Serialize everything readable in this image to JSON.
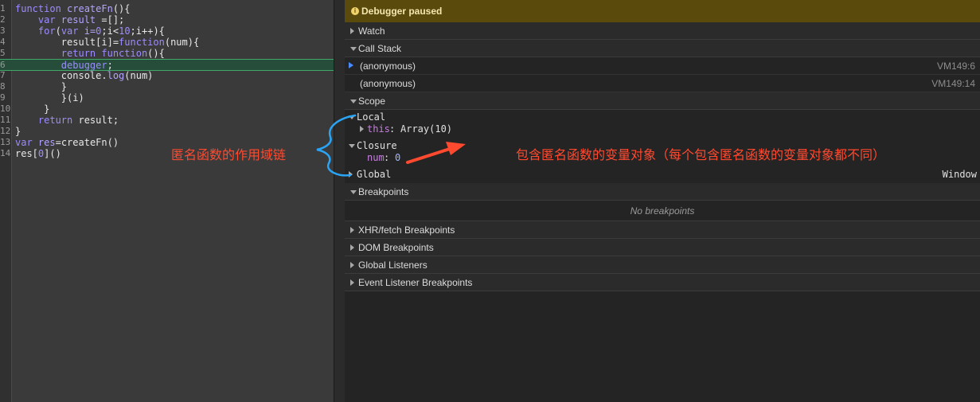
{
  "editor": {
    "lines": [
      {
        "n": "1",
        "tokens": [
          {
            "t": "function ",
            "c": "kw"
          },
          {
            "t": "createFn",
            "c": "fn"
          },
          {
            "t": "(){",
            "c": "pl"
          }
        ]
      },
      {
        "n": "2",
        "tokens": [
          {
            "t": "    var ",
            "c": "kw"
          },
          {
            "t": "result ",
            "c": "fn"
          },
          {
            "t": "=[];",
            "c": "pl"
          }
        ]
      },
      {
        "n": "3",
        "tokens": [
          {
            "t": "    for",
            "c": "kw"
          },
          {
            "t": "(",
            "c": "pl"
          },
          {
            "t": "var ",
            "c": "kw"
          },
          {
            "t": "i=",
            "c": "fn"
          },
          {
            "t": "0",
            "c": "num"
          },
          {
            "t": ";i<",
            "c": "pl"
          },
          {
            "t": "10",
            "c": "num"
          },
          {
            "t": ";i++){",
            "c": "pl"
          }
        ]
      },
      {
        "n": "4",
        "tokens": [
          {
            "t": "        result[i]=",
            "c": "pl"
          },
          {
            "t": "function",
            "c": "kw"
          },
          {
            "t": "(num){",
            "c": "pl"
          }
        ]
      },
      {
        "n": "5",
        "tokens": [
          {
            "t": "        return function",
            "c": "kw"
          },
          {
            "t": "(){",
            "c": "pl"
          }
        ]
      },
      {
        "n": "6",
        "tokens": [
          {
            "t": "        debugger",
            "c": "kw"
          },
          {
            "t": ";",
            "c": "pl"
          }
        ],
        "active": true
      },
      {
        "n": "7",
        "tokens": [
          {
            "t": "        console.",
            "c": "pl"
          },
          {
            "t": "log",
            "c": "fn"
          },
          {
            "t": "(num)",
            "c": "pl"
          }
        ]
      },
      {
        "n": "8",
        "tokens": [
          {
            "t": "        }",
            "c": "pl"
          }
        ]
      },
      {
        "n": "9",
        "tokens": [
          {
            "t": "        }(i)",
            "c": "pl"
          }
        ]
      },
      {
        "n": "10",
        "tokens": [
          {
            "t": "     }",
            "c": "pl"
          }
        ]
      },
      {
        "n": "11",
        "tokens": [
          {
            "t": "    return ",
            "c": "kw"
          },
          {
            "t": "result;",
            "c": "pl"
          }
        ]
      },
      {
        "n": "12",
        "tokens": [
          {
            "t": "}",
            "c": "pl"
          }
        ]
      },
      {
        "n": "13",
        "tokens": [
          {
            "t": "var ",
            "c": "kw"
          },
          {
            "t": "res",
            "c": "fn"
          },
          {
            "t": "=createFn()",
            "c": "pl"
          }
        ]
      },
      {
        "n": "14",
        "tokens": [
          {
            "t": "res[",
            "c": "pl"
          },
          {
            "t": "0",
            "c": "num"
          },
          {
            "t": "]()",
            "c": "pl"
          }
        ]
      }
    ]
  },
  "sidebar": {
    "banner": {
      "icon": "info-icon",
      "text": "Debugger paused",
      "color": "#5a4a0c"
    },
    "watch": "Watch",
    "call_stack": {
      "label": "Call Stack",
      "frames": [
        {
          "name": "(anonymous)",
          "location": "VM149:6",
          "current": true
        },
        {
          "name": "(anonymous)",
          "location": "VM149:14",
          "current": false
        }
      ]
    },
    "scope": {
      "label": "Scope",
      "local": "Local",
      "this_key": "this",
      "this_val": "Array(10)",
      "closure": "Closure",
      "num_key": "num",
      "num_val": "0",
      "global": "Global",
      "global_val": "Window"
    },
    "breakpoints": {
      "label": "Breakpoints",
      "empty": "No breakpoints"
    },
    "xhr": "XHR/fetch Breakpoints",
    "dom": "DOM Breakpoints",
    "global_listeners": "Global Listeners",
    "event_listeners": "Event Listener Breakpoints"
  },
  "annotations": {
    "left": "匿名函数的作用域链",
    "right": "包含匿名函数的变量对象（每个包含匿名函数的变量对象都不同）",
    "color": "#ff4a2f",
    "brace_color": "#2aa4f4"
  }
}
